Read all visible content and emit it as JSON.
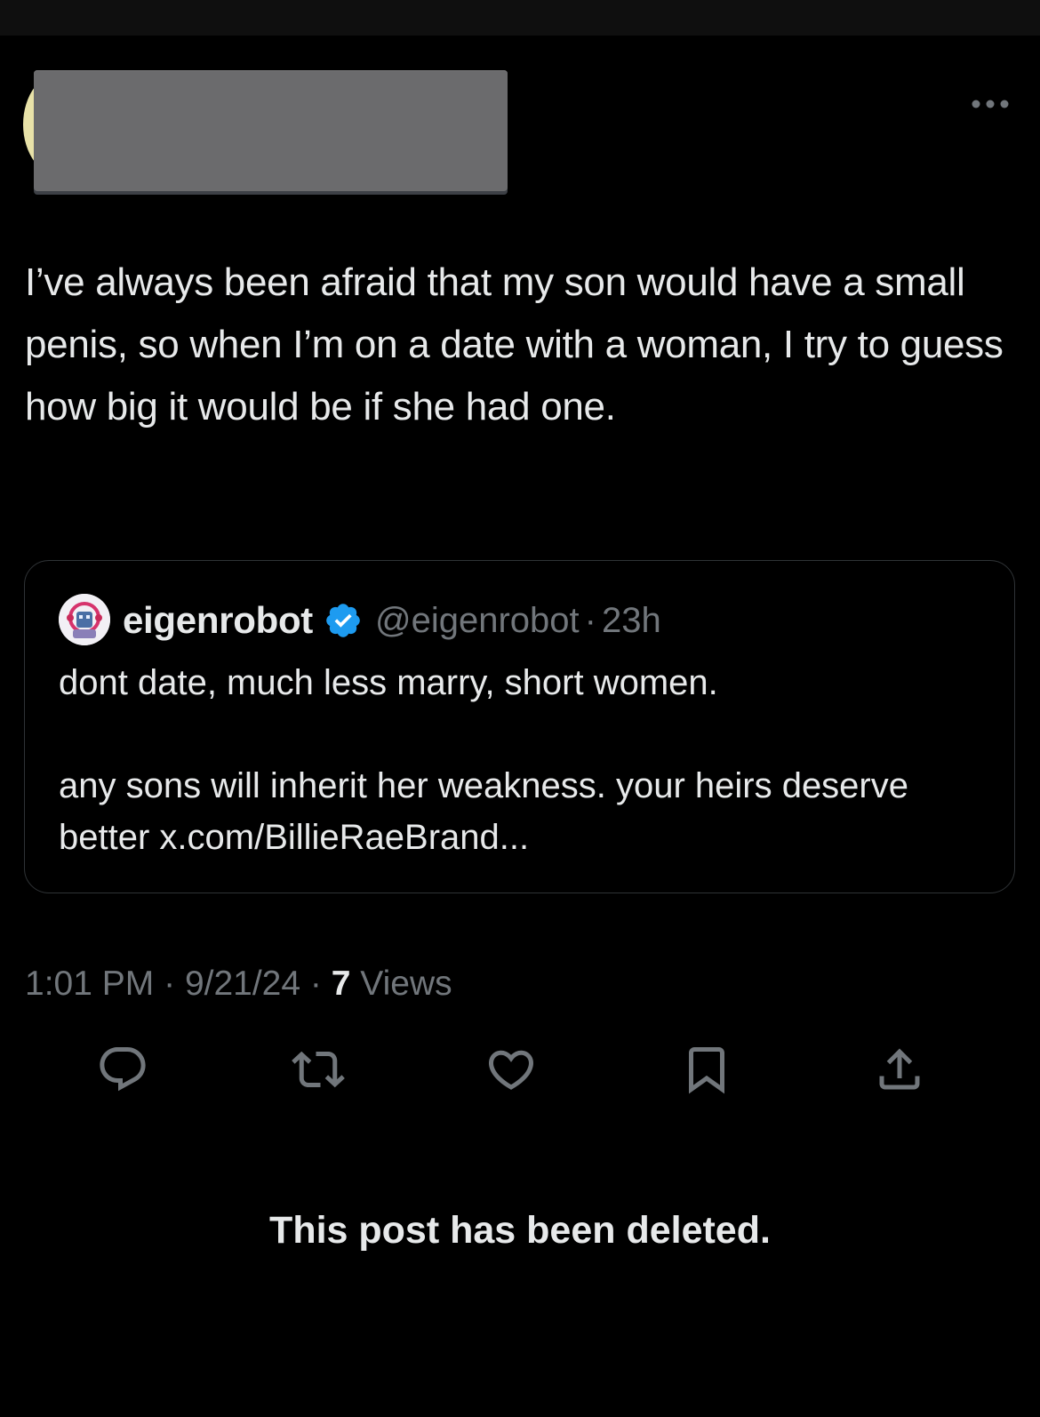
{
  "tweet": {
    "text": "I’ve always been afraid that my son would have a small penis, so when I’m on a date with a woman, I try to guess how big it would be if she had one.",
    "meta": {
      "time": "1:01 PM",
      "date": "9/21/24",
      "sep": "·",
      "views_count": "7",
      "views_label": "Views"
    }
  },
  "quote": {
    "name": "eigenrobot",
    "handle": "@eigenrobot",
    "sep": "·",
    "time": "23h",
    "text": "dont date, much less marry, short women.\n\nany sons will inherit her weakness. your heirs deserve better x.com/BillieRaeBrand..."
  },
  "notice": {
    "deleted": "This post has been deleted."
  },
  "icons": {
    "more": "more-horizontal-icon",
    "verified": "verified-badge-icon",
    "reply": "reply-icon",
    "repost": "repost-icon",
    "like": "heart-icon",
    "bookmark": "bookmark-icon",
    "share": "share-icon"
  },
  "colors": {
    "background": "#000000",
    "text_primary": "#e7e9ea",
    "text_secondary": "#71767b",
    "border": "#2f3336",
    "verified": "#1d9bf0"
  }
}
